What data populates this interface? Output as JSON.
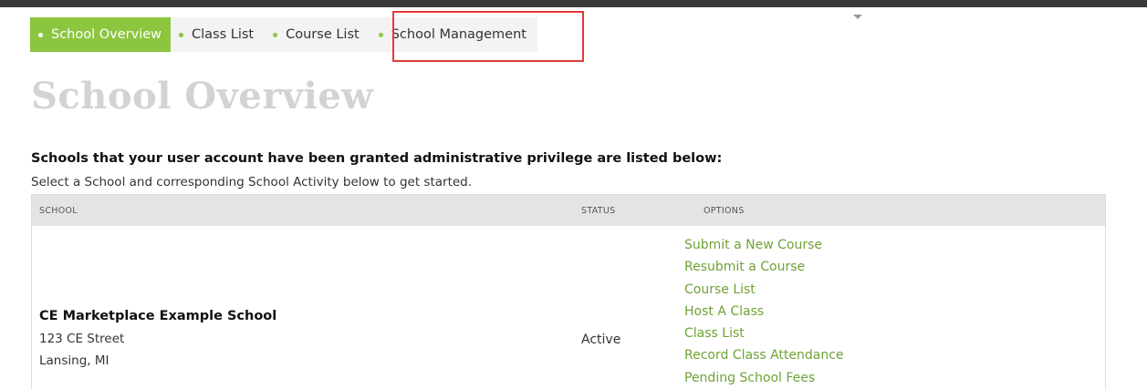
{
  "nav": {
    "tabs": [
      {
        "label": "School Overview",
        "active": true
      },
      {
        "label": "Class List",
        "active": false
      },
      {
        "label": "Course List",
        "active": false
      },
      {
        "label": "School Management",
        "active": false
      }
    ],
    "highlighted_tab": "School Management"
  },
  "page": {
    "title": "School Overview",
    "intro_bold": "Schools that your user account have been granted administrative privilege are listed below:",
    "intro_sub": "Select a School and corresponding School Activity below to get started."
  },
  "table": {
    "headers": {
      "school": "SCHOOL",
      "status": "STATUS",
      "options": "OPTIONS"
    },
    "rows": [
      {
        "school_name": "CE Marketplace Example School",
        "address_line1": "123 CE Street",
        "address_line2": "Lansing, MI",
        "status": "Active",
        "options": [
          "Submit a New Course",
          "Resubmit a Course",
          "Course List",
          "Host A Class",
          "Class List",
          "Record Class Attendance",
          "Pending School Fees"
        ]
      }
    ]
  },
  "colors": {
    "accent_green": "#8cc63f",
    "link_green": "#6fa234",
    "highlight_red": "#e53935",
    "title_gray": "#d3d3d3",
    "header_bg": "#e4e4e4"
  }
}
